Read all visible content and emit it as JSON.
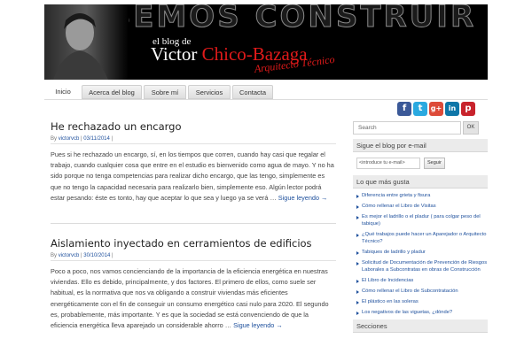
{
  "header": {
    "big_word": "ABEMOS CONSTRUIR",
    "blog_pre": "el blog de",
    "first_name": "Victor",
    "last_name": "Chico-Bazaga",
    "subtitle": "Arquitecto Técnico"
  },
  "nav": [
    {
      "label": "Inicio"
    },
    {
      "label": "Acerca del blog"
    },
    {
      "label": "Sobre mí"
    },
    {
      "label": "Servicios"
    },
    {
      "label": "Contacta"
    }
  ],
  "social": [
    {
      "icon": "facebook-icon",
      "glyph": "f",
      "color": "#3b5998"
    },
    {
      "icon": "twitter-icon",
      "glyph": "t",
      "color": "#2aa9e0"
    },
    {
      "icon": "google-plus-icon",
      "glyph": "g+",
      "color": "#dd4b39"
    },
    {
      "icon": "linkedin-icon",
      "glyph": "in",
      "color": "#0e76a8"
    },
    {
      "icon": "pinterest-icon",
      "glyph": "p",
      "color": "#c8232c"
    }
  ],
  "posts": [
    {
      "title": "He rechazado un encargo",
      "by": "By",
      "author": "victorvcb",
      "sep": "|",
      "date": "03/11/2014",
      "trail": "|",
      "body": "Pues si he rechazado un encargo, sí, en los tiempos que corren, cuando hay casi que regalar el trabajo, cuando cualquier cosa que entre en el estudio es bienvenido como agua de mayo. Y no ha sido porque no tenga competencias para realizar dicho encargo,  que las tengo, simplemente es que no tengo la capacidad necesaria para realizarlo bien, simplemente eso. Algún lector podrá estar pesando: éste es tonto, hay que aceptar lo que sea y luego ya se verá …",
      "more": "Sigue leyendo →"
    },
    {
      "title": "Aislamiento inyectado en cerramientos de edificios",
      "by": "By",
      "author": "victorvcb",
      "sep": "|",
      "date": "30/10/2014",
      "trail": "|",
      "body": "Poco a poco, nos vamos concienciando de la importancia de la eficiencia energética en nuestras viviendas. Ello es debido, principalmente, y dos factores. El primero de ellos, como suele ser habitual, es la normativa que nos va obligando a construir viviendas más eficientes energéticamente con el fin de conseguir un consumo energético casi nulo para 2020. El segundo es, probablemente, más importante. Y es que la sociedad se está convenciendo de que la eficiencia energética lleva aparejado un considerable ahorro …",
      "more": "Sigue leyendo →"
    }
  ],
  "sidebar": {
    "search_placeholder": "Search",
    "search_button": "OK",
    "follow_title": "Sigue el blog por e-mail",
    "email_placeholder": "<introduce tu e-mail>",
    "subscribe": "Seguir",
    "liked_title": "Lo que más gusta",
    "liked": [
      "Diferencia entre grieta y fisura",
      "Cómo rellenar el Libro de Visitas",
      "Es mejor el ladrillo o el pladur ( para colgar peso del tabique)",
      "¿Qué trabajos puede hacer un Aparejador o Arquitecto Técnico?",
      "Tabiques de ladrillo y pladur",
      "Solicitud de Documentación de Prevención de Riesgos Laborales a Subcontratas en obras de Construcción",
      "El Libro de Incidencias",
      "Cómo rellenar el Libro de Subcontratación",
      "El plástico en las soleras",
      "Los negativos de las viguetas, ¿dónde?"
    ],
    "sections_title": "Secciones"
  }
}
